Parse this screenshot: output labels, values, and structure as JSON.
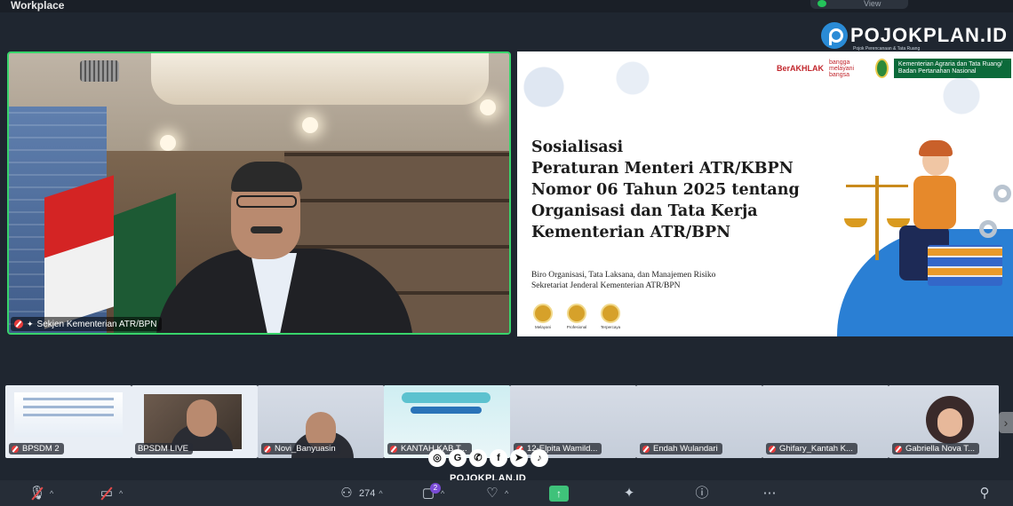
{
  "window": {
    "title": "Workplace",
    "view_label": "View"
  },
  "brand": {
    "name": "POJOKPLAN.ID",
    "tagline": "Pojok Perencanaan & Tata Ruang"
  },
  "speaker": {
    "name": "Sekjen Kementerian ATR/BPN"
  },
  "slide": {
    "logo_berakhlak": "BerAKHLAK",
    "logo_bangga": "bangga melayani bangsa",
    "ministry": "Kementerian Agraria dan Tata Ruang/ Badan Pertanahan Nasional",
    "title": "Sosialisasi\nPeraturan Menteri ATR/KBPN\nNomor 06 Tahun 2025 tentang\nOrganisasi dan Tata Kerja\nKementerian ATR/BPN",
    "subtitle_line1": "Biro Organisasi, Tata Laksana, dan Manajemen Risiko",
    "subtitle_line2": "Sekretariat Jenderal Kementerian ATR/BPN",
    "values": [
      "Melayani",
      "Profesional",
      "Terpercaya"
    ]
  },
  "participants": [
    {
      "name": "BPSDM 2"
    },
    {
      "name": "BPSDM LIVE"
    },
    {
      "name": "Novi_Banyuasin"
    },
    {
      "name": "KANTAH KAB T..."
    },
    {
      "name": "12-Elpita Wamild..."
    },
    {
      "name": "Endah Wulandari"
    },
    {
      "name": "Ghifary_Kantah K..."
    },
    {
      "name": "Gabriella Nova T..."
    }
  ],
  "social": {
    "icons": [
      "instagram-icon",
      "google-icon",
      "whatsapp-icon",
      "facebook-icon",
      "telegram-icon",
      "tiktok-icon"
    ],
    "site": "POJOKPLAN.ID"
  },
  "toolbar": {
    "participants_count": "274",
    "chat_badge": "2"
  },
  "colors": {
    "active_speaker_border": "#38d46b",
    "share_button": "#3fc27a",
    "brand_blue": "#2a8bd6"
  }
}
